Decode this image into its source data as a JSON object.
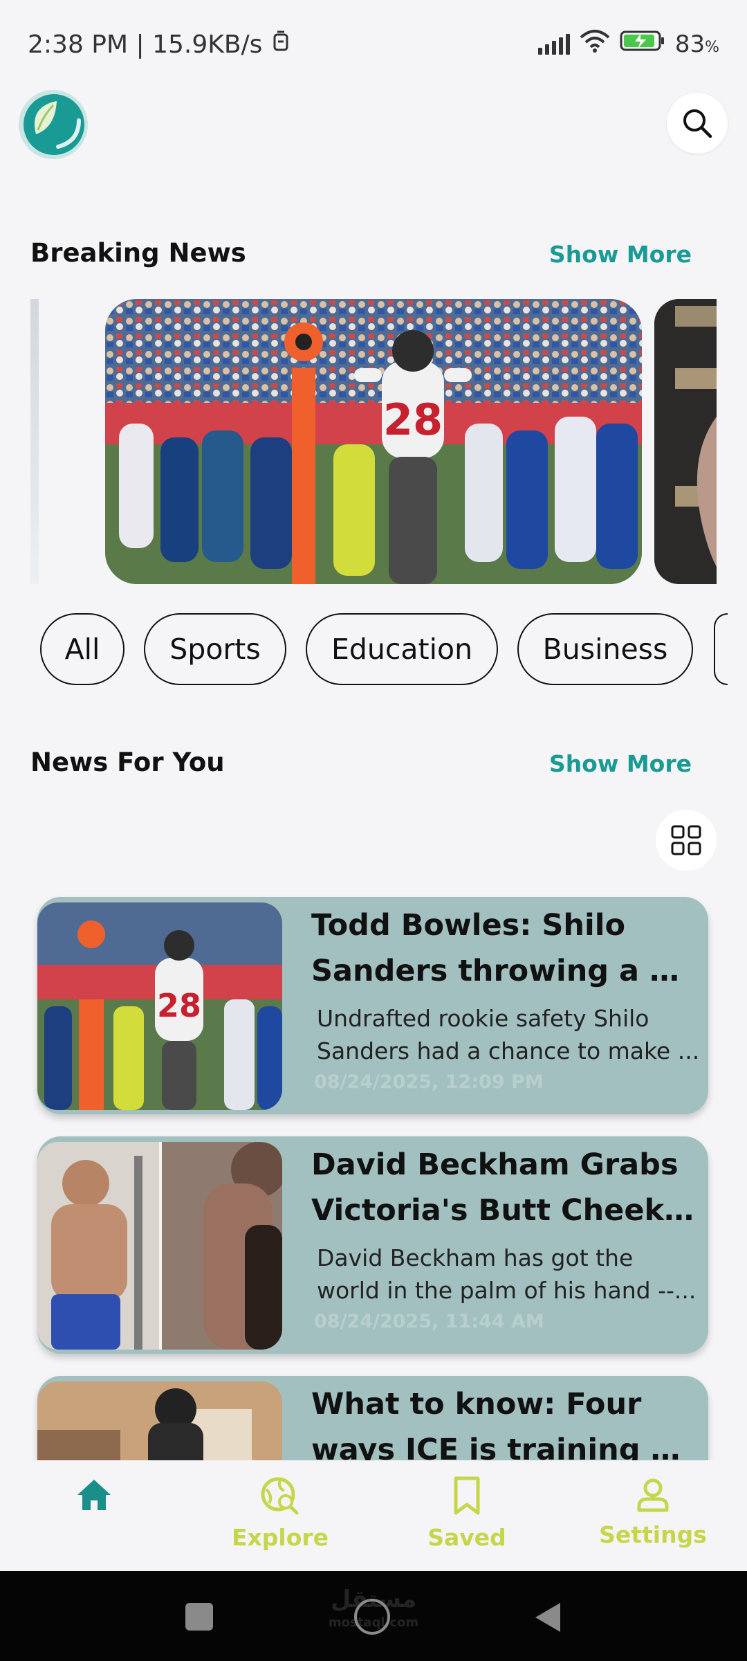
{
  "status_bar": {
    "time_and_speed": "2:38 PM | 15.9KB/s",
    "battery_percent": "83",
    "battery_unit": "%"
  },
  "header": {
    "logo_icon": "leaf-circle-logo",
    "search_icon": "search-icon"
  },
  "breaking": {
    "title": "Breaking News",
    "show_more": "Show More"
  },
  "categories": [
    "All",
    "Sports",
    "Education",
    "Business"
  ],
  "for_you": {
    "title": "News For You",
    "show_more": "Show More"
  },
  "news": [
    {
      "title_line1": "Todd Bowles: Shilo",
      "title_line2": "Sanders throwing a pu...",
      "desc_line1": "Undrafted rookie safety Shilo",
      "desc_line2": "Sanders had a chance to make ...",
      "date": "08/24/2025, 12:09 PM"
    },
    {
      "title_line1": "David Beckham Grabs",
      "title_line2": "Victoria's Butt Cheek o...",
      "desc_line1": "David Beckham has got the",
      "desc_line2": "world in the palm of his hand --...",
      "date": "08/24/2025, 11:44 AM"
    },
    {
      "title_line1": "What to know: Four",
      "title_line2": "ways ICE is training ne..."
    }
  ],
  "bottom_nav": [
    {
      "label": "",
      "icon": "home-icon"
    },
    {
      "label": "Explore",
      "icon": "explore-icon"
    },
    {
      "label": "Saved",
      "icon": "bookmark-icon"
    },
    {
      "label": "Settings",
      "icon": "user-icon"
    }
  ],
  "watermark": {
    "line1": "مستقل",
    "line2": "mostaql.com"
  },
  "colors": {
    "accent_teal": "#1a9a95",
    "nav_inactive": "#c6d64a",
    "card_bg": "#a2c0c0",
    "background": "#f5f5f7"
  }
}
